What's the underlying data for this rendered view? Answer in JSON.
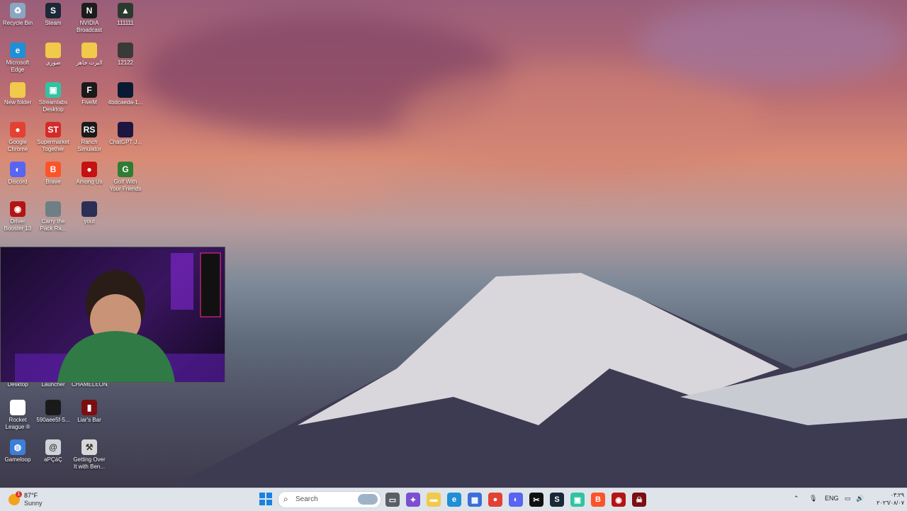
{
  "desktop_icons": [
    {
      "label": "Recycle Bin",
      "icon": "recycle-bin-icon",
      "color": "#8aa6c0",
      "glyph": "♻"
    },
    {
      "label": "Steam",
      "icon": "steam-icon",
      "color": "#1b2838",
      "glyph": "S"
    },
    {
      "label": "NVIDIA Broadcast",
      "icon": "nvidia-icon",
      "color": "#1c1c1c",
      "glyph": "N"
    },
    {
      "label": "111111",
      "icon": "game-shortcut-icon",
      "color": "#2b3a2e",
      "glyph": "▲"
    },
    {
      "label": "Microsoft Edge",
      "icon": "edge-icon",
      "color": "#1f8fd6",
      "glyph": "e"
    },
    {
      "label": "صوري",
      "icon": "folder-icon",
      "color": "#f1c94b",
      "glyph": ""
    },
    {
      "label": "البرت جاهز",
      "icon": "folder-icon",
      "color": "#f1c94b",
      "glyph": ""
    },
    {
      "label": "12122",
      "icon": "image-icon",
      "color": "#3a3a3a",
      "glyph": ""
    },
    {
      "label": "New folder",
      "icon": "folder-icon",
      "color": "#f1c94b",
      "glyph": ""
    },
    {
      "label": "Streamlabs Desktop",
      "icon": "streamlabs-icon",
      "color": "#31c3a2",
      "glyph": "▣"
    },
    {
      "label": "FiveM",
      "icon": "fivem-icon",
      "color": "#1a1a1a",
      "glyph": "F"
    },
    {
      "label": "4bdcaeda-1...",
      "icon": "image-icon",
      "color": "#0b1a33",
      "glyph": ""
    },
    {
      "label": "Google Chrome",
      "icon": "chrome-icon",
      "color": "#e34133",
      "glyph": "●"
    },
    {
      "label": "Supermarket Together",
      "icon": "supermarket-icon",
      "color": "#d42a2a",
      "glyph": "ST"
    },
    {
      "label": "Ranch Simulator",
      "icon": "ranch-icon",
      "color": "#1a1a1a",
      "glyph": "RS"
    },
    {
      "label": "ChatGPT J...",
      "icon": "image-icon",
      "color": "#1d1640",
      "glyph": ""
    },
    {
      "label": "Discord",
      "icon": "discord-icon",
      "color": "#5865f2",
      "glyph": "◐"
    },
    {
      "label": "Brave",
      "icon": "brave-icon",
      "color": "#fb542b",
      "glyph": "B"
    },
    {
      "label": "Among Us",
      "icon": "among-us-icon",
      "color": "#c51111",
      "glyph": "●"
    },
    {
      "label": "Golf With Your Friends",
      "icon": "golf-icon",
      "color": "#2f7d32",
      "glyph": "G"
    },
    {
      "label": "Driver Booster 13",
      "icon": "driver-booster-icon",
      "color": "#b31414",
      "glyph": "◉"
    },
    {
      "label": "Carry the Pack Ra...",
      "icon": "game-shortcut-icon",
      "color": "#6e7f86",
      "glyph": ""
    },
    {
      "label": "yout",
      "icon": "image-icon",
      "color": "#2b2f55",
      "glyph": ""
    },
    {
      "label": "Desktop",
      "icon": "shortcut-icon",
      "color": "#444",
      "glyph": ""
    },
    {
      "label": "Launcher",
      "icon": "shortcut-icon",
      "color": "#444",
      "glyph": ""
    },
    {
      "label": "CHAMELEON",
      "icon": "shortcut-icon",
      "color": "#444",
      "glyph": ""
    },
    {
      "label": "Rocket League ®",
      "icon": "document-icon",
      "color": "#ffffff",
      "glyph": ""
    },
    {
      "label": "590aee5f-5...",
      "icon": "image-icon",
      "color": "#1a1a1a",
      "glyph": ""
    },
    {
      "label": "Liar's Bar",
      "icon": "liars-bar-icon",
      "color": "#7a0e10",
      "glyph": "▮"
    },
    {
      "label": "Gameloop",
      "icon": "gameloop-icon",
      "color": "#3b7fd9",
      "glyph": "◍"
    },
    {
      "label": "aPÇáÇ",
      "icon": "shortcut-icon",
      "color": "#cfd3d8",
      "glyph": "@"
    },
    {
      "label": "Getting Over It with Ben...",
      "icon": "game-shortcut-icon",
      "color": "#d8d8d8",
      "glyph": "⚒"
    }
  ],
  "weather": {
    "temp": "87°F",
    "condition": "Sunny",
    "badge": "1"
  },
  "search": {
    "placeholder": "Search"
  },
  "taskbar_apps": [
    {
      "name": "task-view-icon",
      "color": "#5a5f66",
      "glyph": "▭"
    },
    {
      "name": "widgets-icon",
      "color": "#7b4fd1",
      "glyph": "✦"
    },
    {
      "name": "file-explorer-icon",
      "color": "#f1c94b",
      "glyph": "▬"
    },
    {
      "name": "edge-icon",
      "color": "#1f8fd6",
      "glyph": "e"
    },
    {
      "name": "store-icon",
      "color": "#3a6fd8",
      "glyph": "▦"
    },
    {
      "name": "chrome-icon",
      "color": "#e34133",
      "glyph": "●"
    },
    {
      "name": "discord-icon",
      "color": "#5865f2",
      "glyph": "◐"
    },
    {
      "name": "capcut-icon",
      "color": "#111111",
      "glyph": "✂"
    },
    {
      "name": "steam-icon",
      "color": "#1b2838",
      "glyph": "S"
    },
    {
      "name": "streamlabs-icon",
      "color": "#31c3a2",
      "glyph": "▣"
    },
    {
      "name": "brave-icon",
      "color": "#fb542b",
      "glyph": "B"
    },
    {
      "name": "driver-booster-icon",
      "color": "#b31414",
      "glyph": "◉"
    },
    {
      "name": "game-icon",
      "color": "#7a0e10",
      "glyph": "☠"
    }
  ],
  "tray": {
    "lang": "ENG",
    "time": "٠٣:٢٩",
    "date": "٢٠٢٦/٠٨/٠٧"
  }
}
